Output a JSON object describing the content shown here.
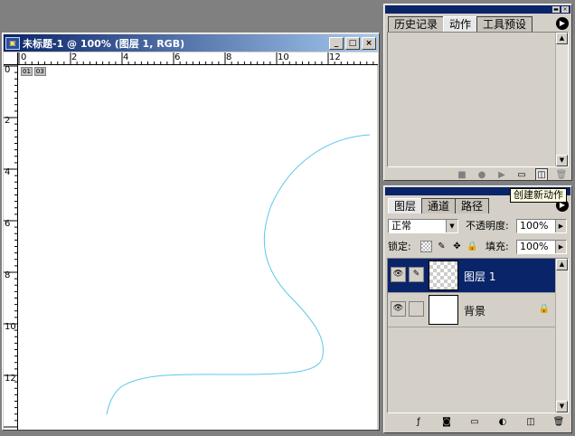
{
  "document": {
    "title": "未标题-1 @ 100% (图层 1, RGB)",
    "icon": "photoshop-document-icon",
    "minimize": "_",
    "maximize": "□",
    "close": "×",
    "ruler_h_labels": [
      "0",
      "2",
      "4",
      "6",
      "8",
      "10",
      "12"
    ],
    "ruler_v_labels": [
      "0",
      "2",
      "4",
      "6",
      "8",
      "10",
      "12"
    ],
    "corner_labels": [
      "01",
      "03"
    ],
    "stroke_color": "#5bc8e8"
  },
  "history_panel": {
    "tabs": [
      "历史记录",
      "动作",
      "工具预设"
    ],
    "active_tab": "动作",
    "tooltip": "创建新动作"
  },
  "layers_panel": {
    "tabs": [
      "图层",
      "通道",
      "路径"
    ],
    "active_tab": "图层",
    "blend_mode": "正常",
    "opacity_label": "不透明度:",
    "opacity_value": "100%",
    "lock_label": "锁定:",
    "fill_label": "填充:",
    "fill_value": "100%",
    "layers": [
      {
        "name": "图层 1",
        "selected": true,
        "transparent": true,
        "locked": false
      },
      {
        "name": "背景",
        "selected": false,
        "transparent": false,
        "locked": true
      }
    ]
  },
  "colors": {
    "title_active": "#0a246a",
    "title_gradient_end": "#a6caf0",
    "panel_bg": "#d4d0c8",
    "workspace_bg": "#808080",
    "selection": "#0a246a"
  }
}
